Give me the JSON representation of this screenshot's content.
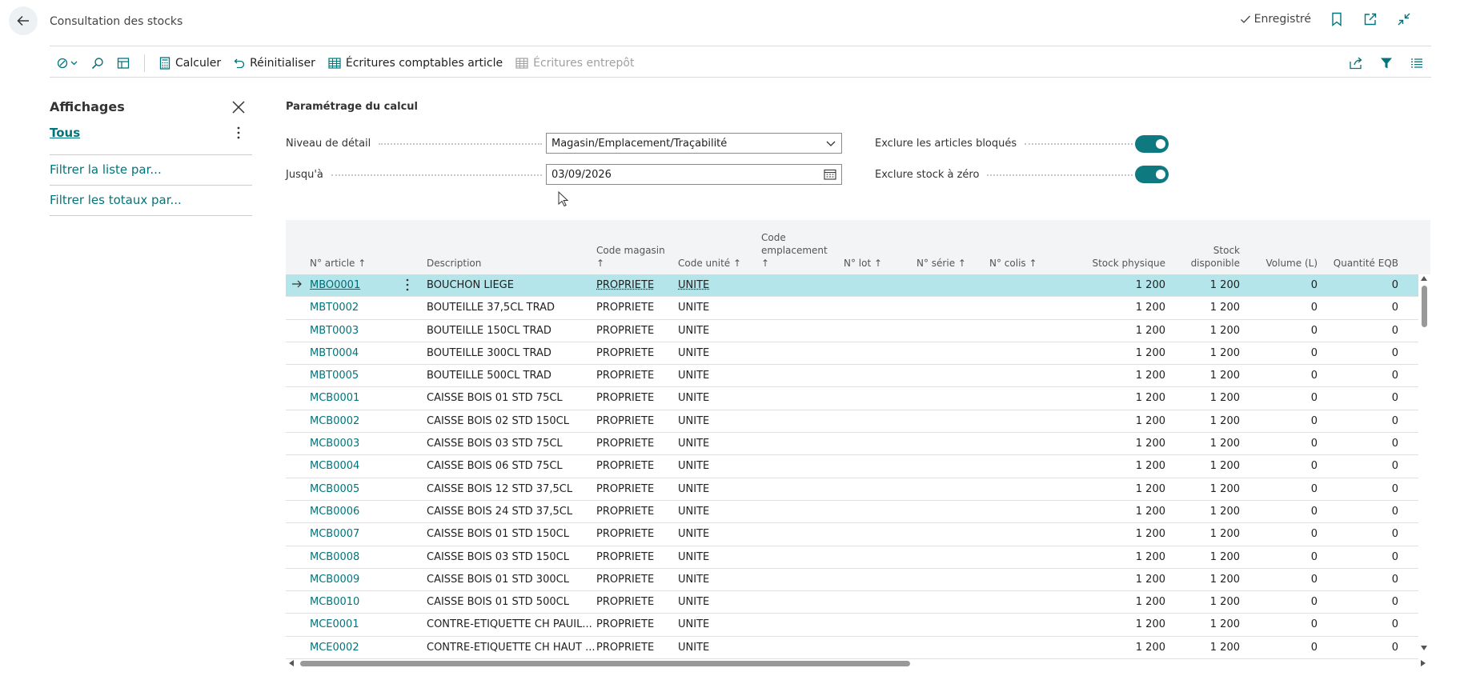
{
  "header": {
    "title": "Consultation des stocks",
    "saved_label": "Enregistré"
  },
  "actions": {
    "calculer": "Calculer",
    "reinitialiser": "Réinitialiser",
    "ecritures_article": "Écritures comptables article",
    "ecritures_entrepot": "Écritures entrepôt"
  },
  "views": {
    "title": "Affichages",
    "tous": "Tous",
    "filter_list": "Filtrer la liste par...",
    "filter_totals": "Filtrer les totaux par..."
  },
  "calc": {
    "title": "Paramétrage du calcul",
    "niveau_label": "Niveau de détail",
    "niveau_value": "Magasin/Emplacement/Traçabilité",
    "jusqua_label": "Jusqu'à",
    "jusqua_value": "03/09/2026",
    "exclure_bloques_label": "Exclure les articles bloqués",
    "exclure_zero_label": "Exclure stock à zéro",
    "exclure_bloques": true,
    "exclure_zero": true
  },
  "columns": {
    "no_article": "N° article ↑",
    "description": "Description",
    "code_magasin_1": "Code magasin",
    "code_magasin_2": "↑",
    "code_unite": "Code unité ↑",
    "code_empl_1": "Code",
    "code_empl_2": "emplacement",
    "code_empl_3": "↑",
    "no_lot": "N° lot ↑",
    "no_serie": "N° série ↑",
    "no_colis": "N° colis ↑",
    "stock_physique": "Stock physique",
    "stock_dispo_1": "Stock",
    "stock_dispo_2": "disponible",
    "volume": "Volume (L)",
    "quantite_eqb": "Quantité EQB"
  },
  "rows": [
    {
      "no": "MBO0001",
      "desc": "BOUCHON LIEGE",
      "mag": "PROPRIETE",
      "unit": "UNITE",
      "phys": "1 200",
      "dispo": "1 200",
      "vol": "0",
      "eqb": "0"
    },
    {
      "no": "MBT0002",
      "desc": "BOUTEILLE 37,5CL TRAD",
      "mag": "PROPRIETE",
      "unit": "UNITE",
      "phys": "1 200",
      "dispo": "1 200",
      "vol": "0",
      "eqb": "0"
    },
    {
      "no": "MBT0003",
      "desc": "BOUTEILLE 150CL TRAD",
      "mag": "PROPRIETE",
      "unit": "UNITE",
      "phys": "1 200",
      "dispo": "1 200",
      "vol": "0",
      "eqb": "0"
    },
    {
      "no": "MBT0004",
      "desc": "BOUTEILLE 300CL TRAD",
      "mag": "PROPRIETE",
      "unit": "UNITE",
      "phys": "1 200",
      "dispo": "1 200",
      "vol": "0",
      "eqb": "0"
    },
    {
      "no": "MBT0005",
      "desc": "BOUTEILLE 500CL TRAD",
      "mag": "PROPRIETE",
      "unit": "UNITE",
      "phys": "1 200",
      "dispo": "1 200",
      "vol": "0",
      "eqb": "0"
    },
    {
      "no": "MCB0001",
      "desc": "CAISSE BOIS 01 STD 75CL",
      "mag": "PROPRIETE",
      "unit": "UNITE",
      "phys": "1 200",
      "dispo": "1 200",
      "vol": "0",
      "eqb": "0"
    },
    {
      "no": "MCB0002",
      "desc": "CAISSE BOIS 02 STD 150CL",
      "mag": "PROPRIETE",
      "unit": "UNITE",
      "phys": "1 200",
      "dispo": "1 200",
      "vol": "0",
      "eqb": "0"
    },
    {
      "no": "MCB0003",
      "desc": "CAISSE BOIS 03 STD 75CL",
      "mag": "PROPRIETE",
      "unit": "UNITE",
      "phys": "1 200",
      "dispo": "1 200",
      "vol": "0",
      "eqb": "0"
    },
    {
      "no": "MCB0004",
      "desc": "CAISSE BOIS 06 STD 75CL",
      "mag": "PROPRIETE",
      "unit": "UNITE",
      "phys": "1 200",
      "dispo": "1 200",
      "vol": "0",
      "eqb": "0"
    },
    {
      "no": "MCB0005",
      "desc": "CAISSE BOIS 12 STD 37,5CL",
      "mag": "PROPRIETE",
      "unit": "UNITE",
      "phys": "1 200",
      "dispo": "1 200",
      "vol": "0",
      "eqb": "0"
    },
    {
      "no": "MCB0006",
      "desc": "CAISSE BOIS 24 STD 37,5CL",
      "mag": "PROPRIETE",
      "unit": "UNITE",
      "phys": "1 200",
      "dispo": "1 200",
      "vol": "0",
      "eqb": "0"
    },
    {
      "no": "MCB0007",
      "desc": "CAISSE BOIS 01 STD 150CL",
      "mag": "PROPRIETE",
      "unit": "UNITE",
      "phys": "1 200",
      "dispo": "1 200",
      "vol": "0",
      "eqb": "0"
    },
    {
      "no": "MCB0008",
      "desc": "CAISSE BOIS 03 STD 150CL",
      "mag": "PROPRIETE",
      "unit": "UNITE",
      "phys": "1 200",
      "dispo": "1 200",
      "vol": "0",
      "eqb": "0"
    },
    {
      "no": "MCB0009",
      "desc": "CAISSE BOIS 01 STD 300CL",
      "mag": "PROPRIETE",
      "unit": "UNITE",
      "phys": "1 200",
      "dispo": "1 200",
      "vol": "0",
      "eqb": "0"
    },
    {
      "no": "MCB0010",
      "desc": "CAISSE BOIS 01 STD 500CL",
      "mag": "PROPRIETE",
      "unit": "UNITE",
      "phys": "1 200",
      "dispo": "1 200",
      "vol": "0",
      "eqb": "0"
    },
    {
      "no": "MCE0001",
      "desc": "CONTRE-ETIQUETTE CH PAUIL...",
      "mag": "PROPRIETE",
      "unit": "UNITE",
      "phys": "1 200",
      "dispo": "1 200",
      "vol": "0",
      "eqb": "0"
    },
    {
      "no": "MCE0002",
      "desc": "CONTRE-ETIQUETTE CH HAUT ...",
      "mag": "PROPRIETE",
      "unit": "UNITE",
      "phys": "1 200",
      "dispo": "1 200",
      "vol": "0",
      "eqb": "0"
    }
  ],
  "icons": {
    "back": "arrow-left-icon",
    "saved": "checkmark-icon",
    "bookmark": "bookmark-icon",
    "open_new": "open-new-window-icon",
    "collapse": "collapse-icon",
    "edit_mode": "edit-mode-icon",
    "search": "search-icon",
    "table_view": "table-view-icon",
    "share": "share-icon",
    "filter": "filter-icon",
    "list": "list-icon"
  },
  "colors": {
    "accent": "#00757b",
    "selected_row": "#b3e5ea",
    "toggle_on": "#0e7a80"
  }
}
